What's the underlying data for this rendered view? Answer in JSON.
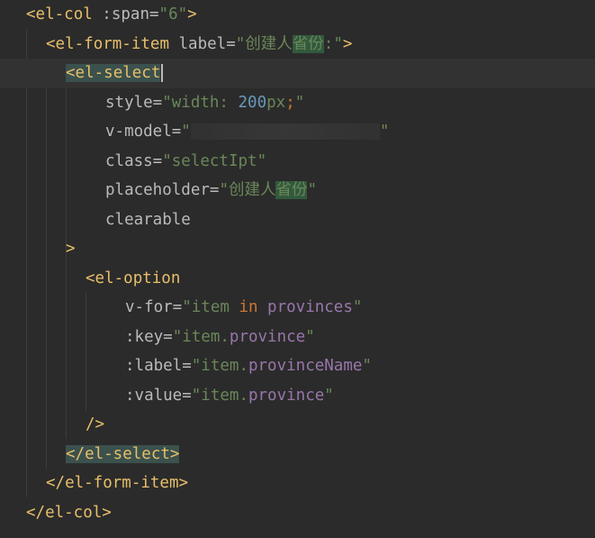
{
  "lines": [
    {
      "t": "<"
    },
    {
      "t": "el-col"
    },
    {
      "t": " :span="
    },
    {
      "t": "\"6\""
    },
    {
      "t": ">"
    }
  ],
  "code": {
    "l1_open": "<",
    "l1_tag": "el-col",
    "l1_attr": " :span=",
    "l1_val": "\"6\"",
    "l1_close": ">",
    "l2_open": "<",
    "l2_tag": "el-form-item",
    "l2_attr": " label=",
    "l2_val1": "\"创建人",
    "l2_hl": "省份",
    "l2_val2": ":\"",
    "l2_close": ">",
    "l3_open": "<",
    "l3_tag": "el-select",
    "l4_attr": "style=",
    "l4_q1": "\"width: ",
    "l4_num": "200",
    "l4_px": "px",
    "l4_semi": ";",
    "l4_q2": "\"",
    "l5_attr": "v-model=",
    "l5_q1": "\"",
    "l5_q2": "\"",
    "l6_attr": "class=",
    "l6_val": "\"selectIpt\"",
    "l7_attr": "placeholder=",
    "l7_val1": "\"创建人",
    "l7_hl": "省份",
    "l7_val2": "\"",
    "l8_attr": "clearable",
    "l9_close": ">",
    "l10_open": "<",
    "l10_tag": "el-option",
    "l11_attr": "v-for=",
    "l11_q1": "\"item ",
    "l11_in": "in",
    "l11_prov": " provinces",
    "l11_q2": "\"",
    "l12_attr": ":key=",
    "l12_q1": "\"item.",
    "l12_prop": "province",
    "l12_q2": "\"",
    "l13_attr": ":label=",
    "l13_q1": "\"item.",
    "l13_prop": "provinceName",
    "l13_q2": "\"",
    "l14_attr": ":value=",
    "l14_q1": "\"item.",
    "l14_prop": "province",
    "l14_q2": "\"",
    "l15_close": "/>",
    "l16_open": "</",
    "l16_tag": "el-select",
    "l16_close": ">",
    "l17_open": "</",
    "l17_tag": "el-form-item",
    "l17_close": ">",
    "l18_open": "</",
    "l18_tag": "el-col",
    "l18_close": ">"
  }
}
